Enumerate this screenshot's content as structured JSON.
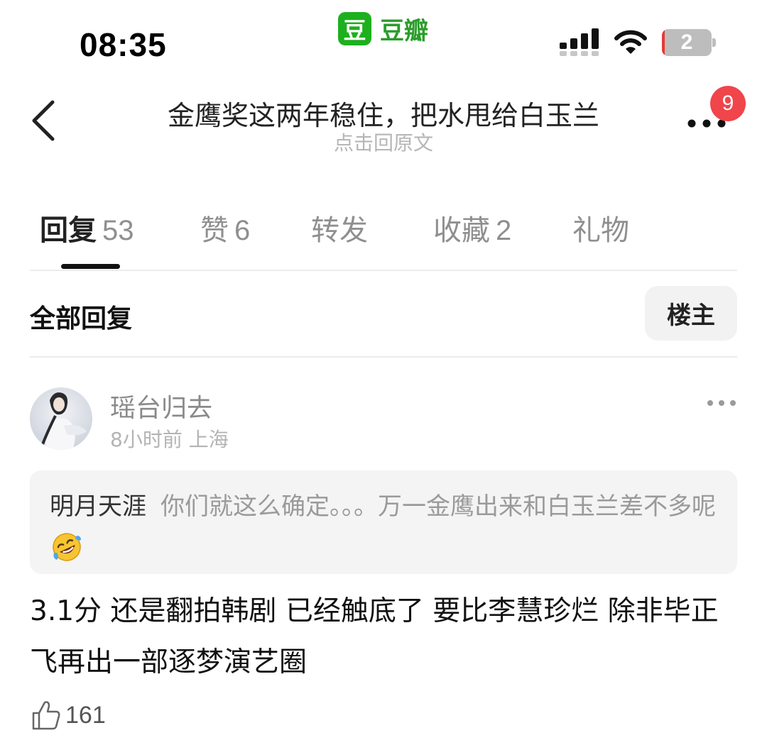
{
  "status_bar": {
    "time": "08:35",
    "app_logo_char": "豆",
    "app_name": "豆瓣",
    "battery_level": "2",
    "battery_fraction": 0.02,
    "icons": [
      "signal-icon",
      "wifi-icon",
      "battery-icon"
    ]
  },
  "header": {
    "title": "金鹰奖这两年稳住，把水甩给白玉兰",
    "subtitle": "点击回原文",
    "notification_count": "9",
    "icons": [
      "back-arrow-icon",
      "more-icon"
    ]
  },
  "tabs": [
    {
      "label": "回复",
      "count": "53",
      "active": true
    },
    {
      "label": "赞",
      "count": "6",
      "active": false
    },
    {
      "label": "转发",
      "count": "",
      "active": false
    },
    {
      "label": "收藏",
      "count": "2",
      "active": false
    },
    {
      "label": "礼物",
      "count": "",
      "active": false
    }
  ],
  "filter": {
    "label": "全部回复",
    "button": "楼主"
  },
  "comment": {
    "author": "瑶台归去",
    "time": "8小时前",
    "location": "上海",
    "quote": {
      "author": "明月天涯",
      "text": "你们就这么确定。。。万一金鹰出来和白玉兰差不多呢"
    },
    "text": "3.1分 还是翻拍韩剧 已经触底了 要比李慧珍烂 除非毕正飞再出一部逐梦演艺圈",
    "likes": "161",
    "icons": [
      "avatar",
      "comment-more-icon",
      "rofl-emoji-icon",
      "thumbs-up-icon"
    ]
  },
  "colors": {
    "brand_green": "#1db01d",
    "notification_red": "#f0454a",
    "battery_red": "#e53935"
  }
}
